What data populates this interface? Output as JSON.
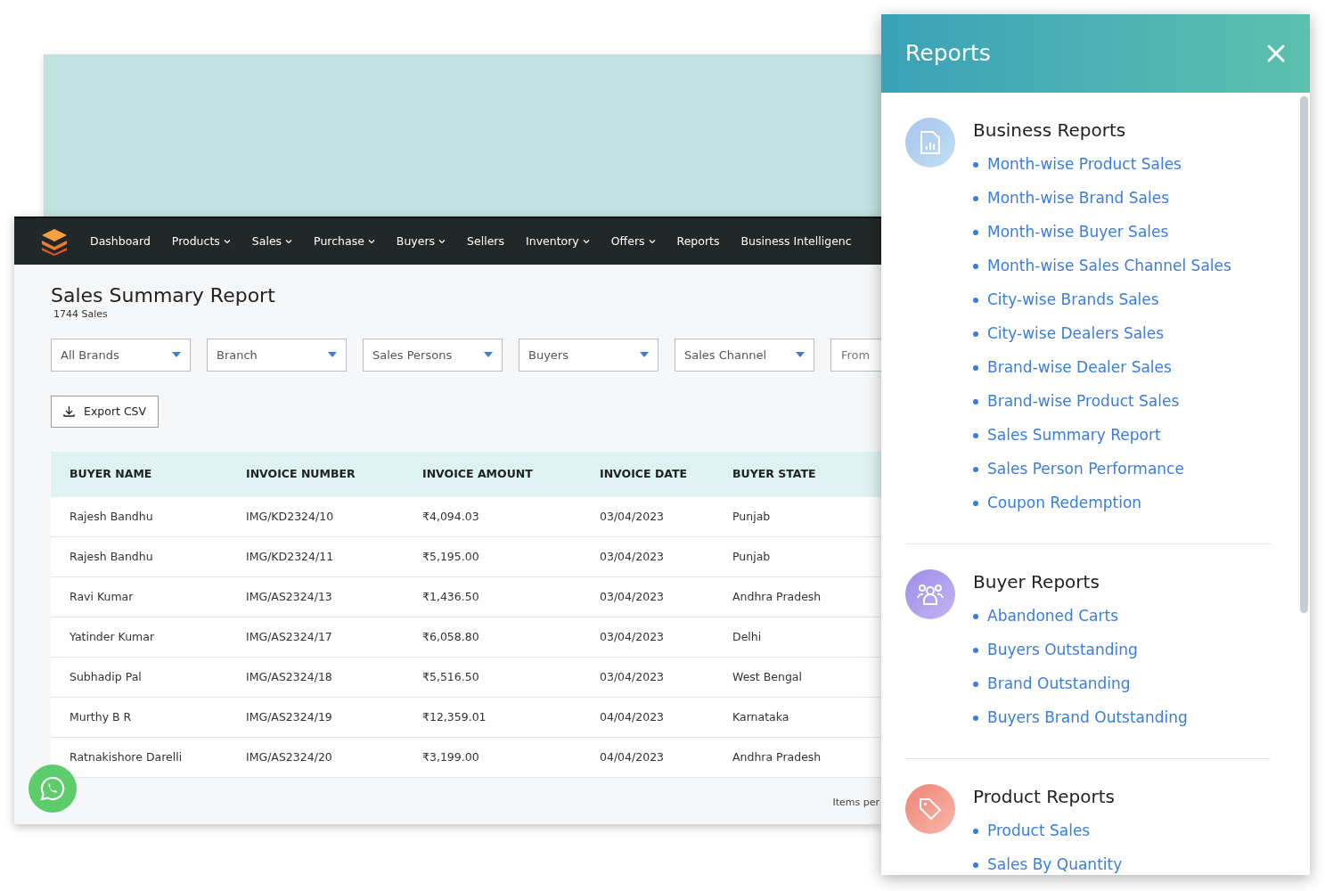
{
  "nav": {
    "items": [
      {
        "label": "Dashboard",
        "has_menu": false
      },
      {
        "label": "Products",
        "has_menu": true
      },
      {
        "label": "Sales",
        "has_menu": true
      },
      {
        "label": "Purchase",
        "has_menu": true
      },
      {
        "label": "Buyers",
        "has_menu": true
      },
      {
        "label": "Sellers",
        "has_menu": false
      },
      {
        "label": "Inventory",
        "has_menu": true
      },
      {
        "label": "Offers",
        "has_menu": true
      },
      {
        "label": "Reports",
        "has_menu": false
      },
      {
        "label": "Business Intelligenc",
        "has_menu": false
      }
    ]
  },
  "page": {
    "title": "Sales Summary Report",
    "subtitle": "1744 Sales",
    "filters": [
      {
        "kind": "select",
        "label": "All Brands"
      },
      {
        "kind": "select",
        "label": "Branch"
      },
      {
        "kind": "select",
        "label": "Sales Persons"
      },
      {
        "kind": "select",
        "label": "Buyers"
      },
      {
        "kind": "select",
        "label": "Sales Channel"
      },
      {
        "kind": "date",
        "placeholder": "From"
      }
    ],
    "export_button": "Export CSV",
    "table": {
      "columns": [
        "BUYER NAME",
        "INVOICE NUMBER",
        "INVOICE AMOUNT",
        "INVOICE DATE",
        "BUYER STATE"
      ],
      "rows": [
        [
          "Rajesh Bandhu",
          "IMG/KD2324/10",
          "₹4,094.03",
          "03/04/2023",
          "Punjab"
        ],
        [
          "Rajesh Bandhu",
          "IMG/KD2324/11",
          "₹5,195.00",
          "03/04/2023",
          "Punjab"
        ],
        [
          "Ravi Kumar",
          "IMG/AS2324/13",
          "₹1,436.50",
          "03/04/2023",
          "Andhra Pradesh"
        ],
        [
          "Yatinder Kumar",
          "IMG/AS2324/17",
          "₹6,058.80",
          "03/04/2023",
          "Delhi"
        ],
        [
          "Subhadip Pal",
          "IMG/AS2324/18",
          "₹5,516.50",
          "03/04/2023",
          "West Bengal"
        ],
        [
          "Murthy B R",
          "IMG/AS2324/19",
          "₹12,359.01",
          "04/04/2023",
          "Karnataka"
        ],
        [
          "Ratnakishore Darelli",
          "IMG/AS2324/20",
          "₹3,199.00",
          "04/04/2023",
          "Andhra Pradesh"
        ]
      ]
    },
    "pagination_label": "Items per"
  },
  "reports_panel": {
    "title": "Reports",
    "sections": [
      {
        "kind": "document",
        "title": "Business Reports",
        "items": [
          "Month-wise Product Sales",
          "Month-wise Brand Sales",
          "Month-wise Buyer Sales",
          "Month-wise Sales Channel Sales",
          "City-wise Brands Sales",
          "City-wise Dealers Sales",
          "Brand-wise Dealer Sales",
          "Brand-wise Product Sales",
          "Sales Summary Report",
          "Sales Person Performance",
          "Coupon Redemption"
        ]
      },
      {
        "kind": "people",
        "title": "Buyer Reports",
        "items": [
          "Abandoned Carts",
          "Buyers Outstanding",
          "Brand Outstanding",
          "Buyers Brand Outstanding"
        ]
      },
      {
        "kind": "tag",
        "title": "Product Reports",
        "items": [
          "Product Sales",
          "Sales By Quantity"
        ]
      }
    ]
  }
}
